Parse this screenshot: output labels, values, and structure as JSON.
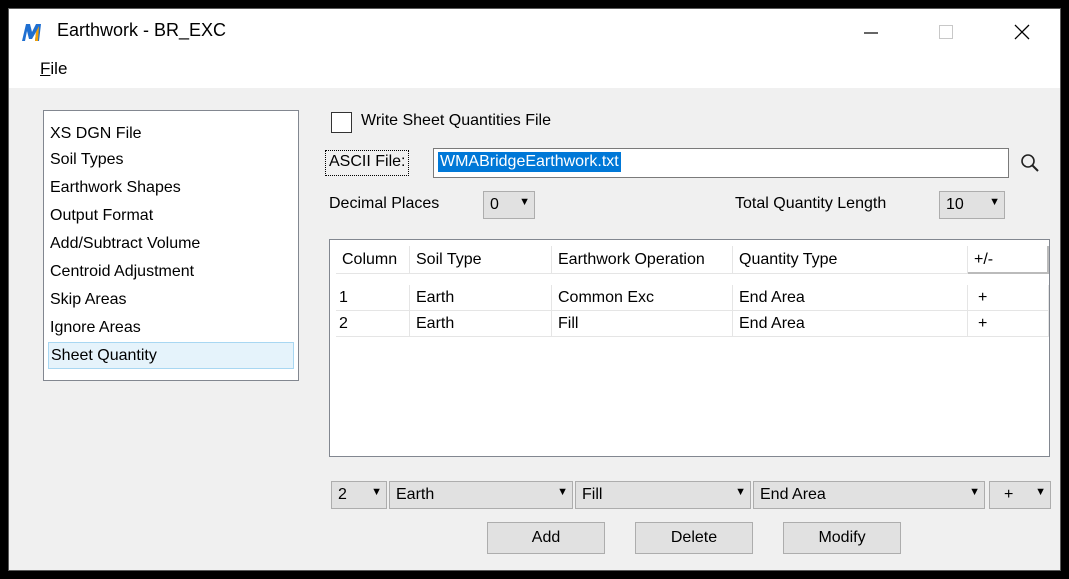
{
  "window": {
    "title": "Earthwork - BR_EXC",
    "icon": "microstation-m-icon",
    "controls": {
      "minimize": "—",
      "maximize": "☐",
      "close": "✕"
    }
  },
  "menu": {
    "file_label": "File",
    "file_mnemonic": "F",
    "file_rest": "ile"
  },
  "nav": {
    "items": [
      "XS DGN File",
      "Soil Types",
      "Earthwork Shapes",
      "Output Format",
      "Add/Subtract Volume",
      "Centroid Adjustment",
      "Skip Areas",
      "Ignore Areas",
      "Sheet Quantity"
    ],
    "selected": "Sheet Quantity"
  },
  "sheet": {
    "write_checkbox_label": "Write Sheet Quantities File",
    "write_checked": false,
    "ascii_label": "ASCII File:",
    "ascii_value": "WMABridgeEarthwork.txt",
    "decimal_label": "Decimal Places",
    "decimal_value": "0",
    "total_length_label": "Total Quantity Length",
    "total_length_value": "10"
  },
  "table": {
    "columns": [
      "Column",
      "Soil Type",
      "Earthwork Operation",
      "Quantity Type",
      "+/-"
    ],
    "rows": [
      [
        "1",
        "Earth",
        "Common Exc",
        "End Area",
        "+"
      ],
      [
        "2",
        "Earth",
        "Fill",
        "End Area",
        "+"
      ]
    ]
  },
  "editors": {
    "column": "2",
    "soil_type": "Earth",
    "operation": "Fill",
    "quantity_type": "End Area",
    "sign": "+"
  },
  "buttons": {
    "add": "Add",
    "delete": "Delete",
    "modify": "Modify"
  },
  "colors": {
    "selection_blue": "#0078d7",
    "nav_selected_bg": "#e5f3fb"
  }
}
